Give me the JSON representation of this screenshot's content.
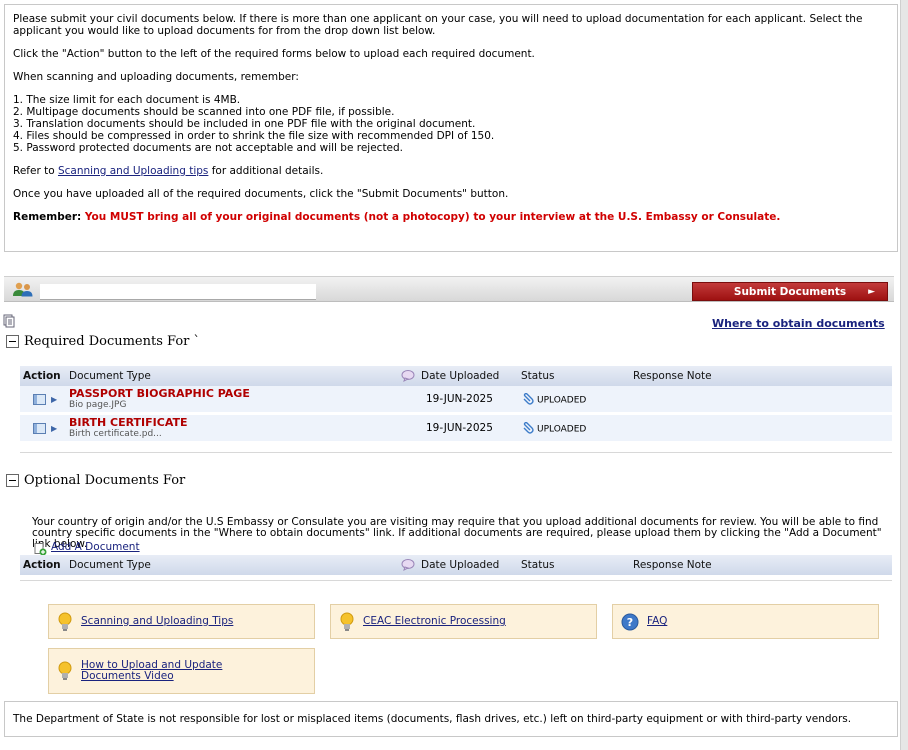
{
  "intro": {
    "p1": "Please submit your civil documents below. If there is more than one applicant on your case, you will need to upload documentation for each applicant. Select the applicant you would like to upload documents for from the drop down list below.",
    "p2": "Click the \"Action\" button to the left of the required forms below to upload each required document.",
    "p3": "When scanning and uploading documents, remember:",
    "rules": [
      "1. The size limit for each document is 4MB.",
      "2. Multipage documents should be scanned into one PDF file, if possible.",
      "3. Translation documents should be included in one PDF file with the original document.",
      "4. Files should be compressed in order to shrink the file size with recommended DPI of 150.",
      "5. Password protected documents are not acceptable and will be rejected."
    ],
    "refer_prefix": "Refer to ",
    "refer_link": "Scanning and Uploading tips",
    "refer_suffix": " for additional details.",
    "p5": "Once you have uploaded all of the required documents, click the \"Submit Documents\" button.",
    "remember_label": "Remember:",
    "remember_text": " You MUST bring all of your original documents (not a photocopy) to your interview at the U.S. Embassy or Consulate."
  },
  "applicant_bar": {
    "selected_applicant": "",
    "submit_label": "Submit Documents",
    "submit_arrow": "►"
  },
  "where_link": "Where to obtain documents",
  "required": {
    "heading": "Required Documents For `",
    "columns": [
      "Action",
      "Document Type",
      "Date Uploaded",
      "Status",
      "Response Note"
    ],
    "rows": [
      {
        "title": "PASSPORT BIOGRAPHIC PAGE",
        "file": "Bio page.JPG",
        "date": "19-JUN-2025",
        "status": "UPLOADED",
        "note": ""
      },
      {
        "title": "BIRTH CERTIFICATE",
        "file": "Birth certificate.pd...",
        "date": "19-JUN-2025",
        "status": "UPLOADED",
        "note": ""
      }
    ]
  },
  "optional": {
    "heading": "Optional Documents For",
    "text": "Your country of origin and/or the U.S Embassy or Consulate you are visiting may require that you upload additional documents for review. You will be able to find country specific documents in the \"Where to obtain documents\" link. If additional documents are required, please upload them by clicking the \"Add a Document\" link below.",
    "add_link": "Add A Document",
    "columns": [
      "Action",
      "Document Type",
      "Date Uploaded",
      "Status",
      "Response Note"
    ]
  },
  "help": {
    "scanning": "Scanning and Uploading Tips",
    "ceac": "CEAC Electronic Processing",
    "faq": "FAQ",
    "video": "How to Upload and Update Documents Video"
  },
  "footer": "The Department of State is not responsible for lost or misplaced items (documents, flash drives, etc.) left on third-party equipment or with third-party vendors.",
  "colors": {
    "accent_red": "#b00000",
    "submit_button": "#9e1111",
    "link": "#1a237e",
    "table_header": "#cfd9ea",
    "help_box": "#fdf2dc"
  },
  "icons": [
    "people-icon",
    "document-icon",
    "collapse-toggle-icon",
    "action-menu-icon",
    "comment-icon",
    "paperclip-status-icon",
    "add-document-icon",
    "lightbulb-icon",
    "question-icon"
  ]
}
